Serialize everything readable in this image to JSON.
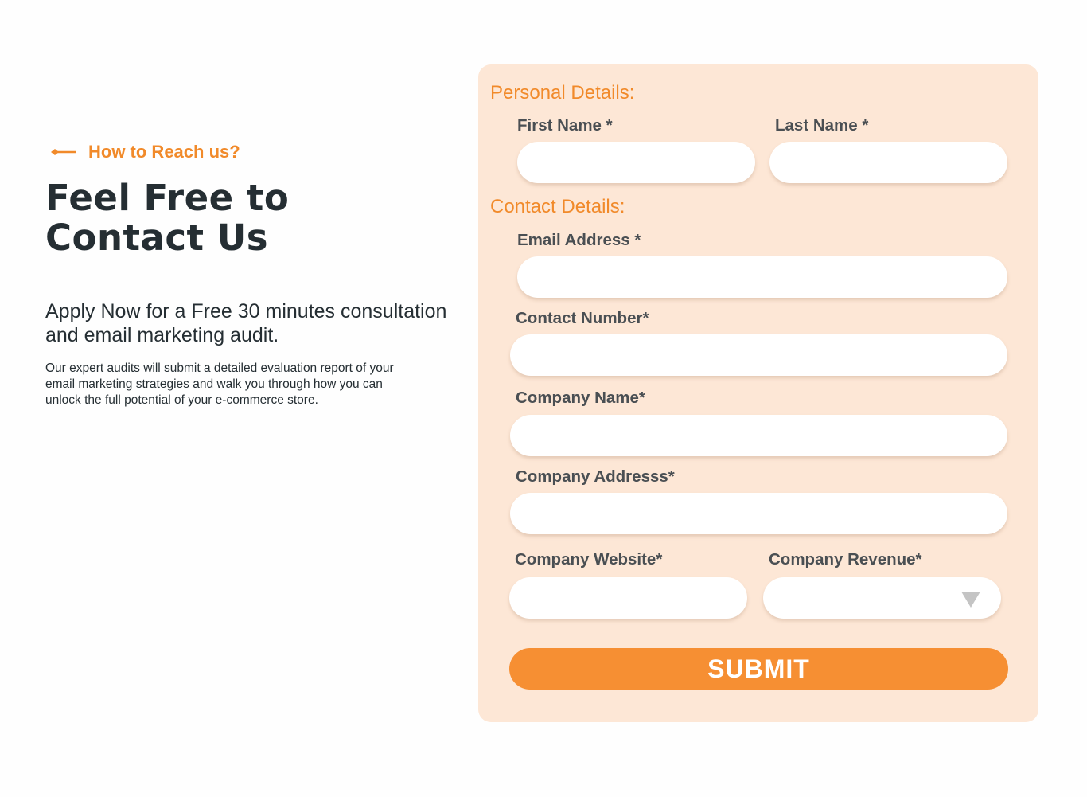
{
  "intro": {
    "eyebrow": "How to Reach us?",
    "eyebrow_icon": "arrow-left-diamond-icon",
    "headline_line1": "Feel Free to",
    "headline_line2": "Contact Us",
    "subheading": "Apply Now for a Free 30 minutes consultation and email marketing audit.",
    "body": "Our expert audits will submit a detailed evaluation report of your email marketing strategies and walk you through how you can unlock the full potential of your e-commerce store."
  },
  "form": {
    "personal_title": "Personal Details:",
    "contact_title": "Contact Details:",
    "first_name_label": "First Name *",
    "first_name_value": "",
    "last_name_label": "Last Name *",
    "last_name_value": "",
    "email_label": "Email Address *",
    "email_value": "",
    "phone_label": "Contact Number*",
    "phone_value": "",
    "company_name_label": "Company Name*",
    "company_name_value": "",
    "company_address_label": "Company Addresss*",
    "company_address_value": "",
    "company_website_label": "Company Website*",
    "company_website_value": "",
    "company_revenue_label": "Company Revenue*",
    "company_revenue_selected": "",
    "submit_label": "SUBMIT"
  },
  "colors": {
    "accent": "#f18a2a",
    "button": "#f68f33",
    "card_bg": "#fde7d6",
    "heading": "#252e33"
  }
}
